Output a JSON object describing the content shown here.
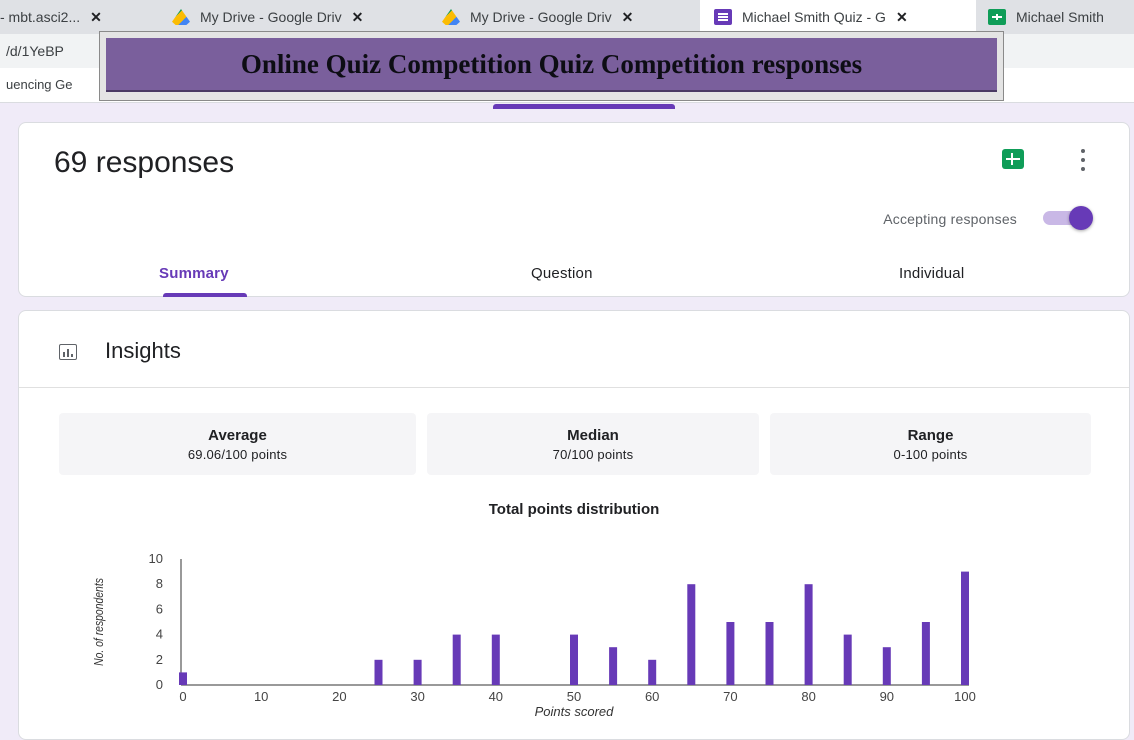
{
  "browser": {
    "tabs": [
      {
        "title": "- mbt.asci2...",
        "icon": "generic",
        "closable": true,
        "active": false
      },
      {
        "title": "My Drive - Google Driv",
        "icon": "google-drive",
        "closable": true,
        "active": false
      },
      {
        "title": "My Drive - Google Driv",
        "icon": "google-drive",
        "closable": true,
        "active": false
      },
      {
        "title": "Michael Smith Quiz - G",
        "icon": "google-forms",
        "closable": true,
        "active": true
      },
      {
        "title": "Michael Smith",
        "icon": "google-sheets",
        "closable": false,
        "active": false
      }
    ],
    "url_fragment": "/d/1YeBP",
    "bookmark_fragment": "uencing Ge"
  },
  "banner": {
    "title": "Online Quiz Competition Quiz Competition responses"
  },
  "responses": {
    "count_label": "69 responses",
    "accepting_label": "Accepting responses",
    "accepting": true,
    "tabs": [
      "Summary",
      "Question",
      "Individual"
    ],
    "active_tab": "Summary"
  },
  "insights": {
    "title": "Insights",
    "stats": [
      {
        "label": "Average",
        "value": "69.06/100 points"
      },
      {
        "label": "Median",
        "value": "70/100 points"
      },
      {
        "label": "Range",
        "value": "0-100 points"
      }
    ]
  },
  "colors": {
    "accent": "#673ab7",
    "sheets": "#0f9d58",
    "banner": "#7a5f9c"
  },
  "chart_data": {
    "type": "bar",
    "title": "Total points distribution",
    "xlabel": "Points scored",
    "ylabel": "No. of respondents",
    "x": [
      0,
      25,
      30,
      35,
      40,
      50,
      55,
      60,
      65,
      70,
      75,
      80,
      85,
      90,
      95,
      100
    ],
    "values": [
      1,
      2,
      2,
      4,
      4,
      4,
      3,
      2,
      8,
      5,
      5,
      8,
      4,
      3,
      5,
      9
    ],
    "xticks": [
      0,
      10,
      20,
      30,
      40,
      50,
      60,
      70,
      80,
      90,
      100
    ],
    "yticks": [
      0,
      2,
      4,
      6,
      8,
      10
    ],
    "xlim": [
      0,
      100
    ],
    "ylim": [
      0,
      10
    ],
    "grid": false,
    "bar_color": "#673ab7"
  }
}
